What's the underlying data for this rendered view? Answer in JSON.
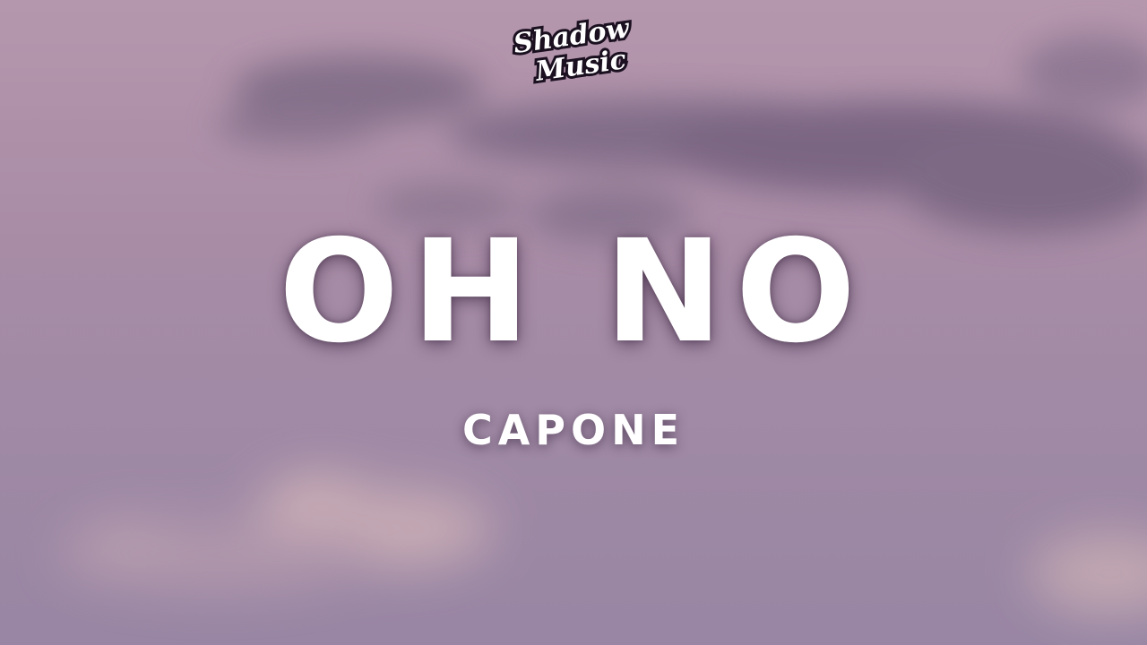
{
  "logo": {
    "line1": "Shadow",
    "line2": "Music"
  },
  "song": {
    "title": "OH NO",
    "artist": "CAPONE"
  },
  "colors": {
    "sky_top": "#b597ad",
    "sky_bottom": "#9886a4",
    "cloud_dark": "#7c6a83",
    "cloud_light": "#d8b8b8",
    "text": "#ffffff"
  }
}
